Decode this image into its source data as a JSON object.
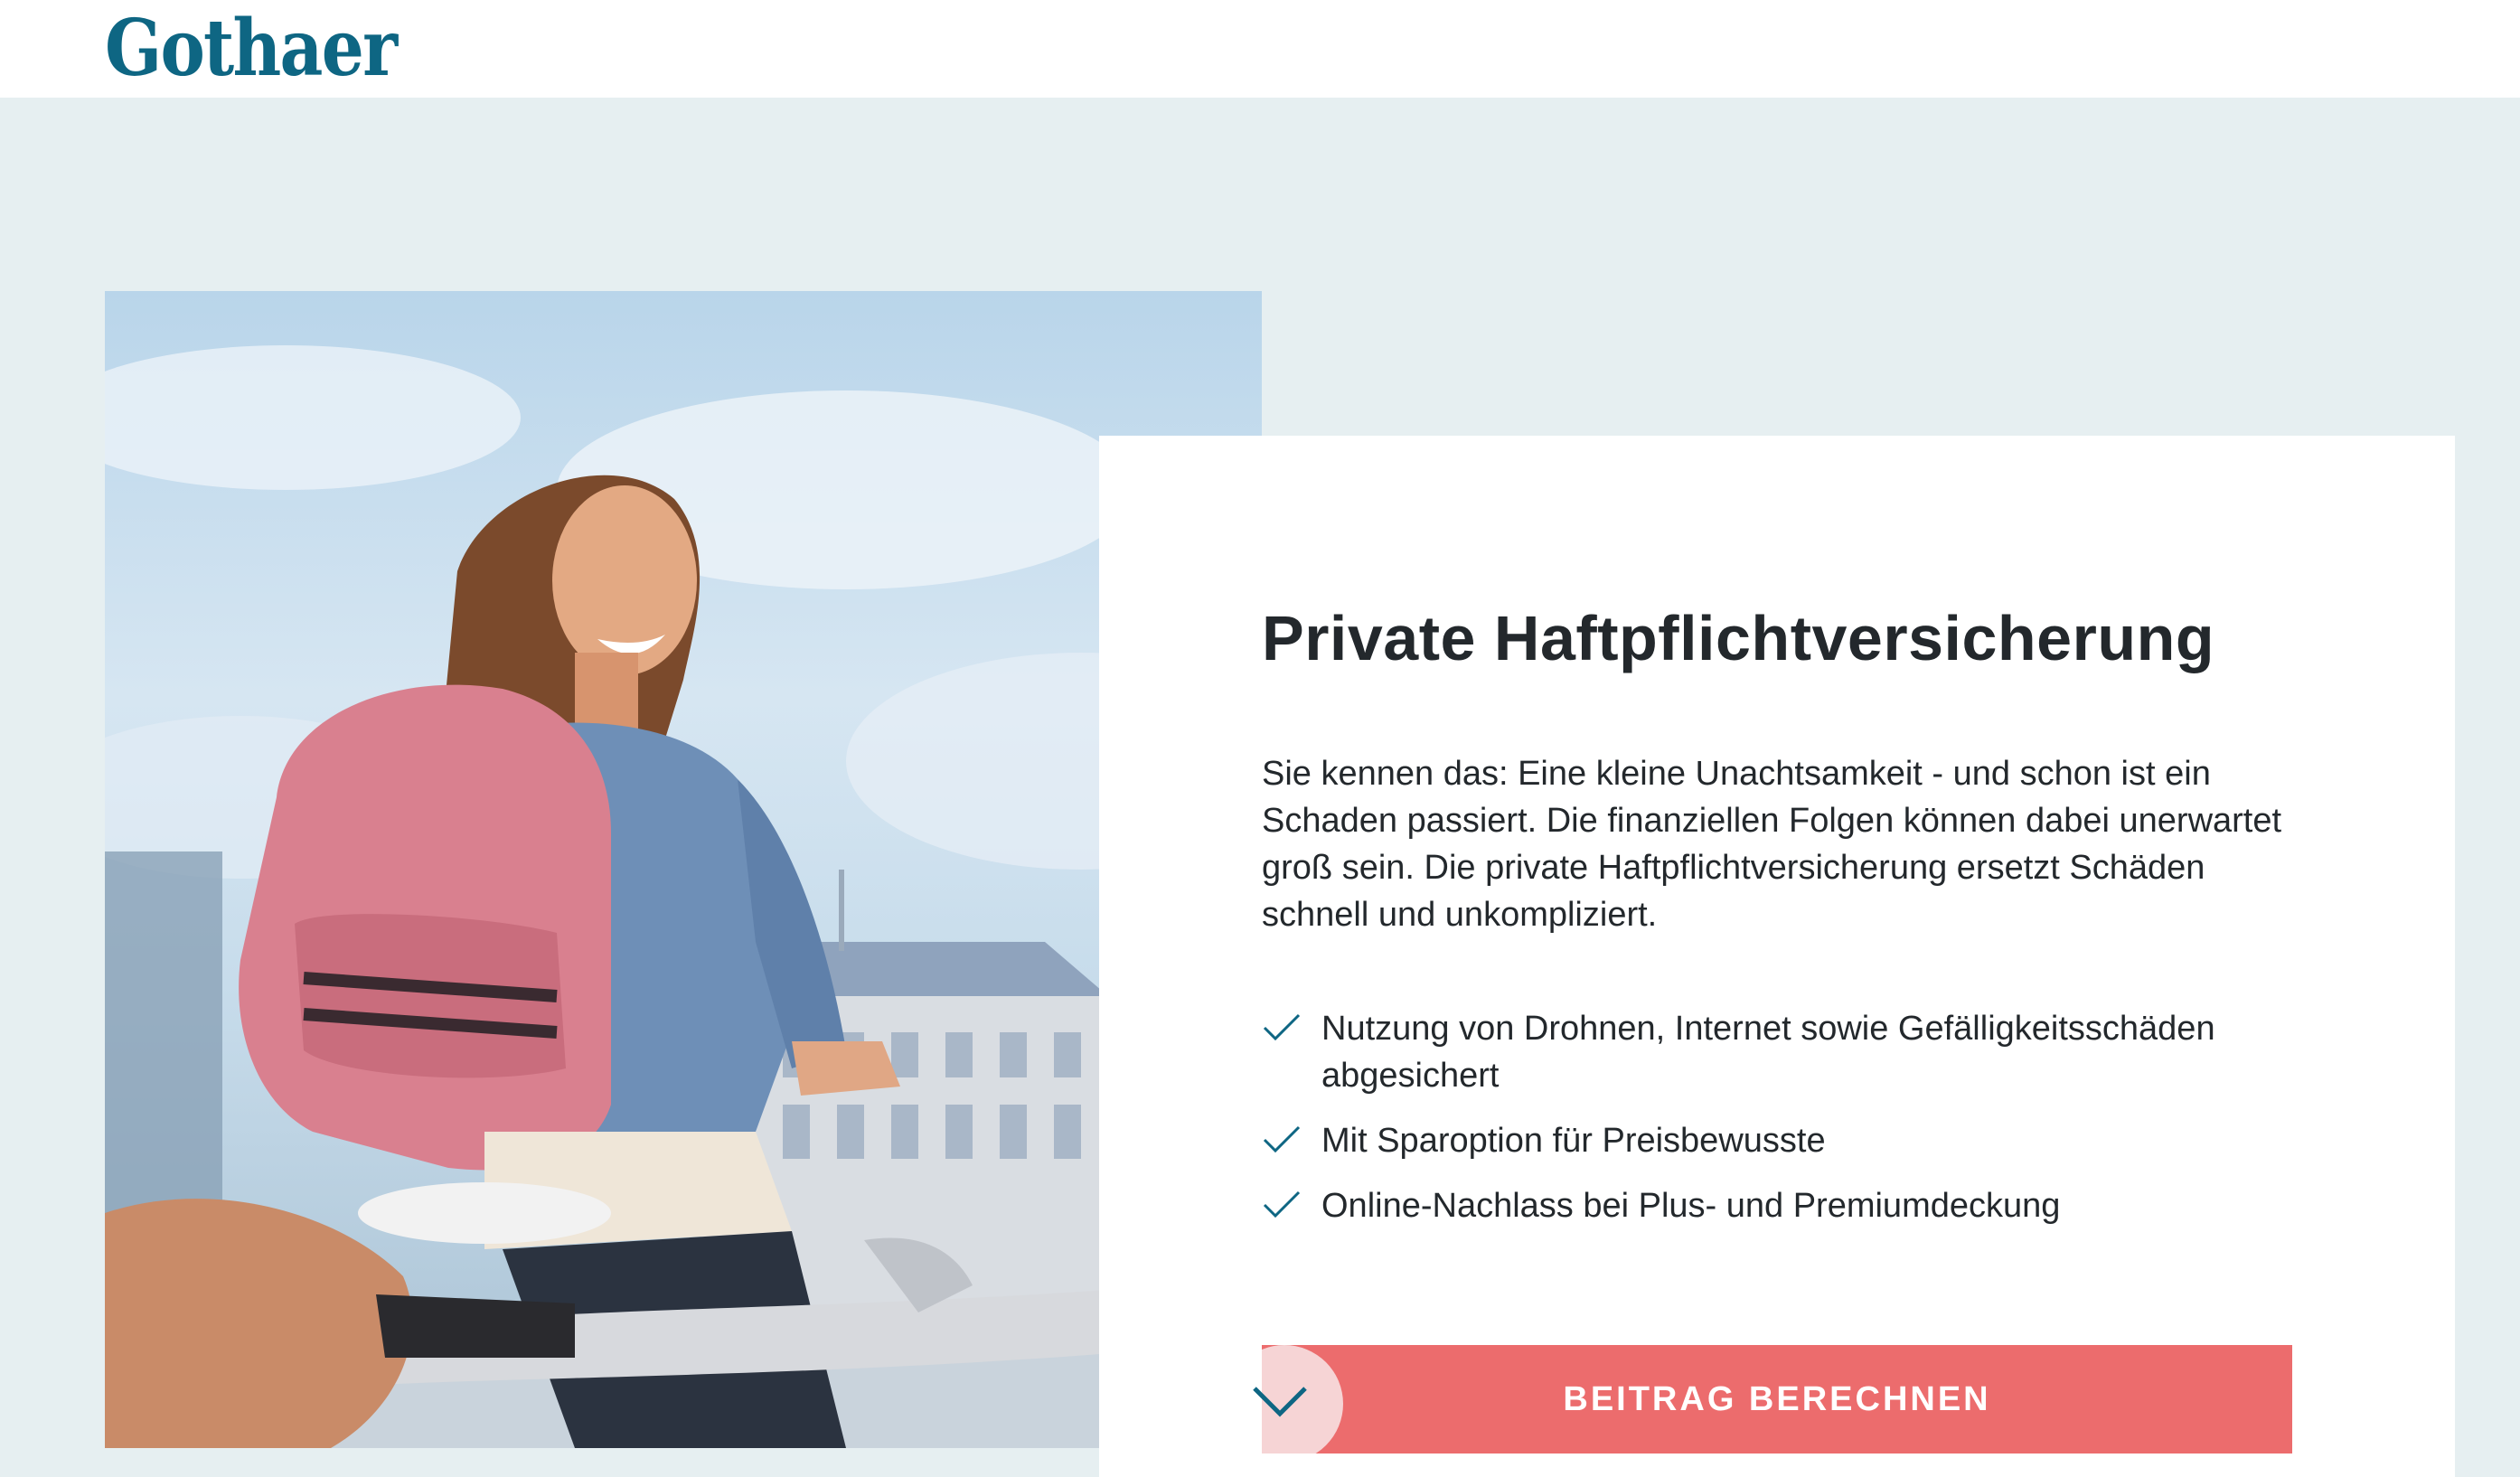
{
  "header": {
    "logo_text": "Gothaer"
  },
  "hero": {
    "image_alt": "Lachende Frau mit rosa Rucksack auf dem Fahrrad"
  },
  "card": {
    "title": "Private Haftpflichtversicherung",
    "intro": "Sie kennen das: Eine kleine Unachtsamkeit - und schon ist ein Schaden passiert. Die finanziellen Folgen können dabei unerwartet groß sein. Die private Haftpflichtversicherung ersetzt Schäden schnell und unkompliziert.",
    "benefits": [
      "Nutzung von Drohnen, Internet sowie Gefälligkeitsschäden abgesichert",
      "Mit Sparoption für Preisbewusste",
      "Online-Nachlass bei Plus- und Premiumdeckung"
    ],
    "cta_label": "BEITRAG BERECHNEN"
  },
  "colors": {
    "brand": "#0e6683",
    "background": "#e6eff1",
    "cta": "#ec6c6d",
    "check": "#0e6683"
  },
  "icons": {
    "check": "check-icon",
    "chevron": "chevron-down-icon"
  }
}
